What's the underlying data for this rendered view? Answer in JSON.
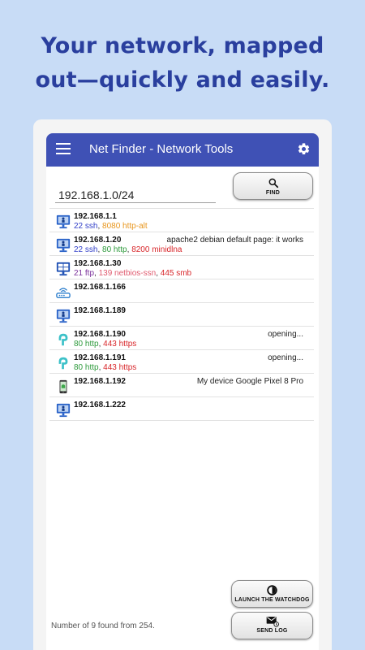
{
  "headline": {
    "line1": "Your network, mapped",
    "line2": "out—quickly and easily."
  },
  "app": {
    "title": "Net Finder - Network Tools",
    "theme_color": "#3f51b5"
  },
  "search": {
    "value": "192.168.1.0/24",
    "find_label": "FIND"
  },
  "devices": [
    {
      "icon": "monitor-icon",
      "ip": "192.168.1.1",
      "ports": [
        {
          "text": "22 ssh",
          "color": "#3340c8"
        },
        {
          "text": "8080 http-alt",
          "color": "#e8961e"
        }
      ],
      "info": ""
    },
    {
      "icon": "monitor-icon",
      "ip": "192.168.1.20",
      "ports": [
        {
          "text": "22 ssh",
          "color": "#3340c8"
        },
        {
          "text": "80 http",
          "color": "#2e9a3c"
        },
        {
          "text": "8200 minidlna",
          "color": "#d8262a"
        }
      ],
      "info": "apache2 debian default page: it works"
    },
    {
      "icon": "windows-icon",
      "ip": "192.168.1.30",
      "ports": [
        {
          "text": "21 ftp",
          "color": "#7a2f9a"
        },
        {
          "text": "139 netbios-ssn",
          "color": "#e05a6e"
        },
        {
          "text": "445 smb",
          "color": "#d8262a"
        }
      ],
      "info": ""
    },
    {
      "icon": "router-icon",
      "ip": "192.168.1.166",
      "ports": [],
      "info": ""
    },
    {
      "icon": "monitor-icon",
      "ip": "192.168.1.189",
      "ports": [],
      "info": ""
    },
    {
      "icon": "tplink-icon",
      "ip": "192.168.1.190",
      "ports": [
        {
          "text": "80 http",
          "color": "#2e9a3c"
        },
        {
          "text": "443 https",
          "color": "#d8262a"
        }
      ],
      "info": "opening..."
    },
    {
      "icon": "tplink-icon",
      "ip": "192.168.1.191",
      "ports": [
        {
          "text": "80 http",
          "color": "#2e9a3c"
        },
        {
          "text": "443 https",
          "color": "#d8262a"
        }
      ],
      "info": "opening..."
    },
    {
      "icon": "android-phone-icon",
      "ip": "192.168.1.192",
      "ports": [],
      "info": "My device  Google Pixel 8 Pro"
    },
    {
      "icon": "monitor-icon",
      "ip": "192.168.1.222",
      "ports": [],
      "info": ""
    }
  ],
  "footer": {
    "status": "Number of 9 found from 254.",
    "watchdog_label": "LAUNCH THE WATCHDOG",
    "sendlog_label": "SEND LOG"
  }
}
